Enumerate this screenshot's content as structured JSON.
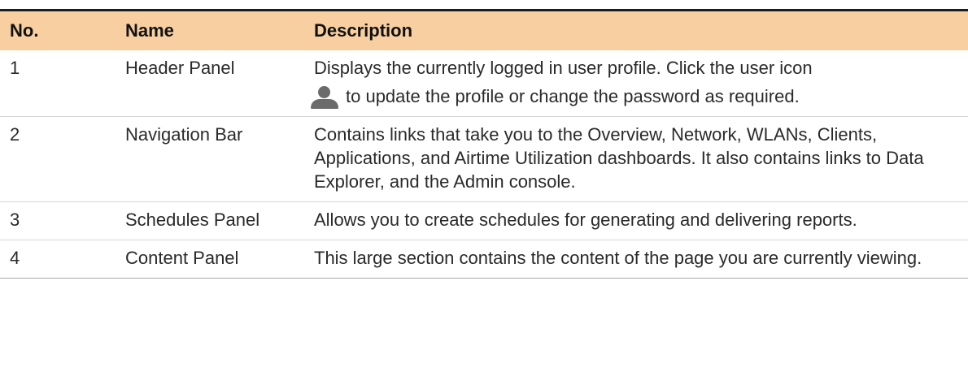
{
  "colors": {
    "header_bg": "#f8cfa0",
    "top_rule": "#1c1c1c",
    "icon": "#6b6b6b"
  },
  "header": {
    "no": "No.",
    "name": "Name",
    "description": "Description"
  },
  "rows": [
    {
      "no": "1",
      "name": "Header Panel",
      "description_line1": "Displays the currently logged in user profile. Click the user icon",
      "icon": "user-icon",
      "description_line2": "to update the profile or change the password as required."
    },
    {
      "no": "2",
      "name": "Navigation Bar",
      "description": "Contains links that take you to the Overview, Network, WLANs, Clients, Applications, and Airtime Utilization dashboards. It also contains links to Data Explorer, and the Admin console."
    },
    {
      "no": "3",
      "name": "Schedules Panel",
      "description": "Allows you to create schedules for generating and delivering reports."
    },
    {
      "no": "4",
      "name": "Content Panel",
      "description": "This large section contains the content of the page you are currently viewing."
    }
  ]
}
